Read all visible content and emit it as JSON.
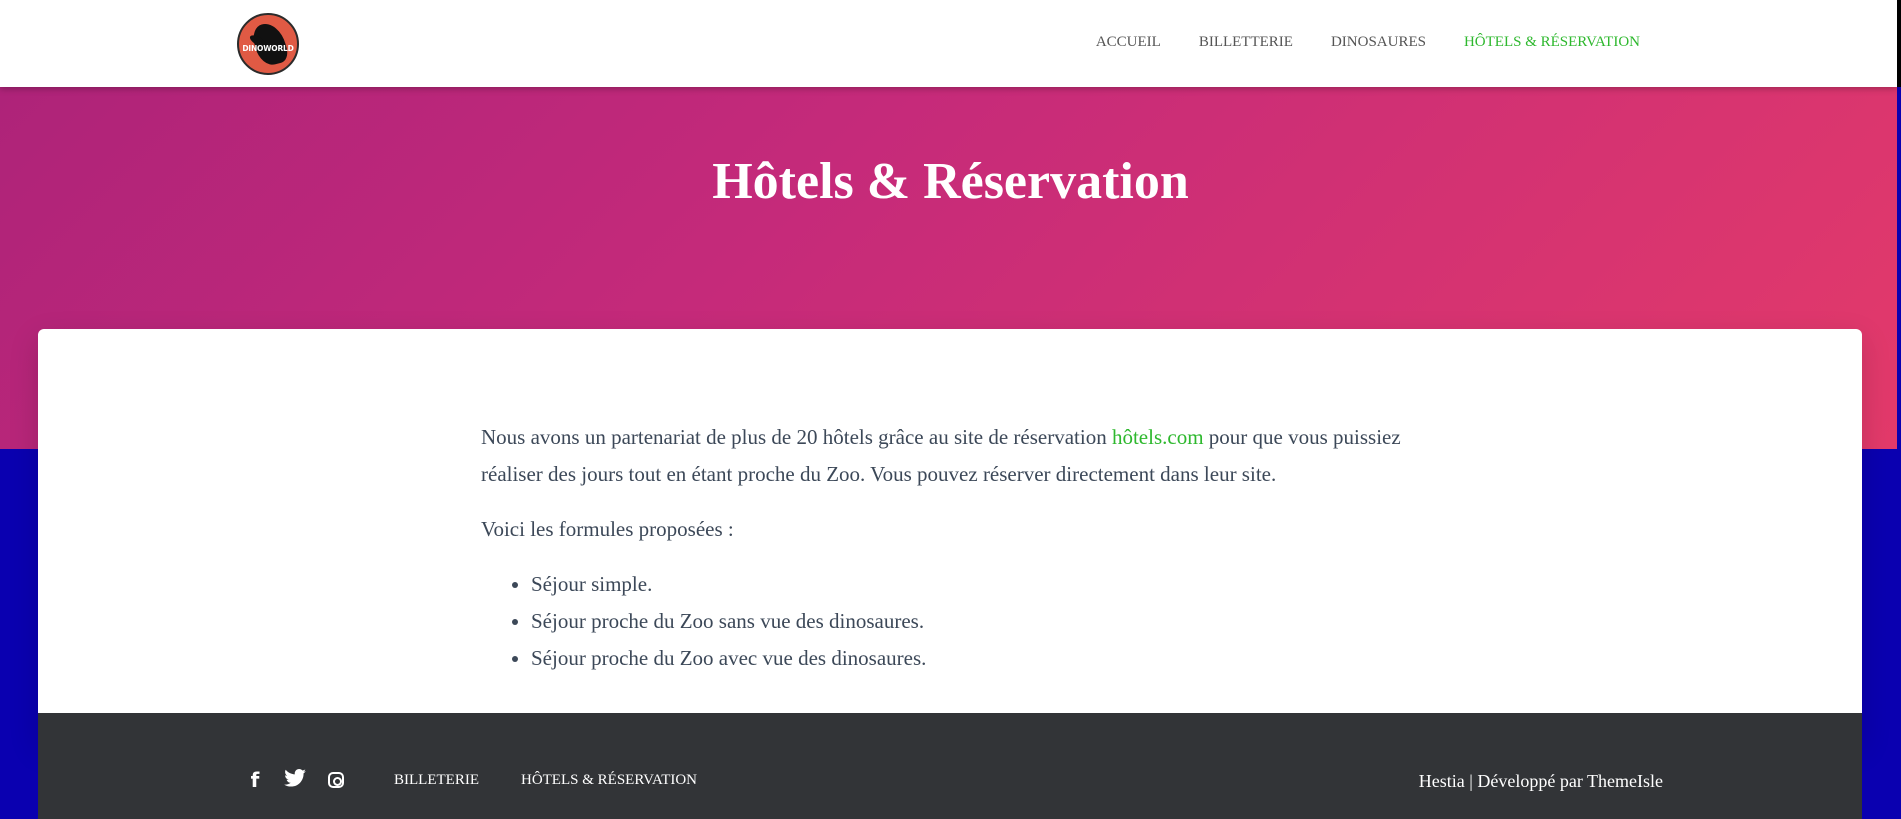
{
  "logo": {
    "text": "DINOWORLD"
  },
  "nav": {
    "items": [
      {
        "label": "ACCUEIL"
      },
      {
        "label": "BILLETTERIE"
      },
      {
        "label": "DINOSAURES"
      },
      {
        "label": "HÔTELS & RÉSERVATION",
        "active": true
      }
    ]
  },
  "hero": {
    "title": "Hôtels & Réservation"
  },
  "content": {
    "para1_before": "Nous avons un partenariat de plus de 20 hôtels grâce au site de réservation ",
    "para1_link": "hôtels.com",
    "para1_after": " pour que vous puissiez réaliser des jours tout en étant proche du Zoo. Vous pouvez réserver directement dans leur site.",
    "para2": "Voici les formules proposées :",
    "list": [
      "Séjour simple.",
      "Séjour proche du Zoo sans vue des dinosaures.",
      "Séjour proche du Zoo avec vue des dinosaures."
    ]
  },
  "footer": {
    "icons": [
      "facebook-icon",
      "twitter-icon",
      "instagram-icon"
    ],
    "links": [
      "BILLETERIE",
      "HÔTELS & RÉSERVATION"
    ],
    "credit_brand": "Hestia",
    "credit_sep": " | ",
    "credit_text": "Développé par ",
    "credit_author": "ThemeIsle"
  },
  "colors": {
    "accent_green": "#2eb82e",
    "hero_gradient_start": "#ae2379",
    "hero_gradient_end": "#e33a6a",
    "footer_bg": "#323437",
    "page_bg": "#0a00b0"
  }
}
